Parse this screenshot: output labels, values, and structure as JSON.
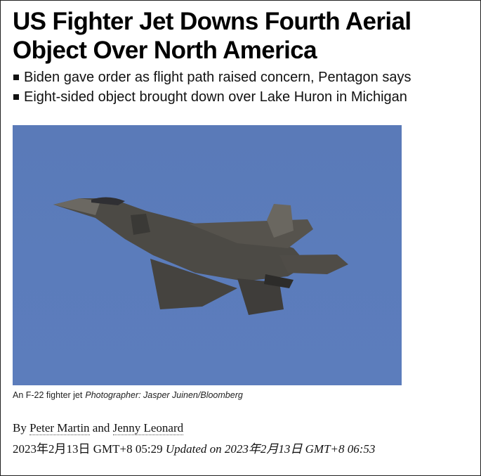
{
  "article": {
    "headline": "US Fighter Jet Downs Fourth Aerial Object Over North America",
    "bullets": [
      "Biden gave order as flight path raised concern, Pentagon says",
      "Eight-sided object brought down over Lake Huron in Michigan"
    ],
    "image": {
      "caption": "An F-22 fighter jet",
      "credit": "Photographer: Jasper Juinen/Bloomberg"
    },
    "byline": {
      "prefix": "By",
      "author1": "Peter Martin",
      "conjunction": "and",
      "author2": "Jenny Leonard"
    },
    "published": "2023年2月13日 GMT+8 05:29",
    "updated": "Updated on 2023年2月13日 GMT+8 06:53"
  },
  "colors": {
    "sky": "#5b7cbb",
    "jet": "#4a4844",
    "text": "#111111"
  }
}
